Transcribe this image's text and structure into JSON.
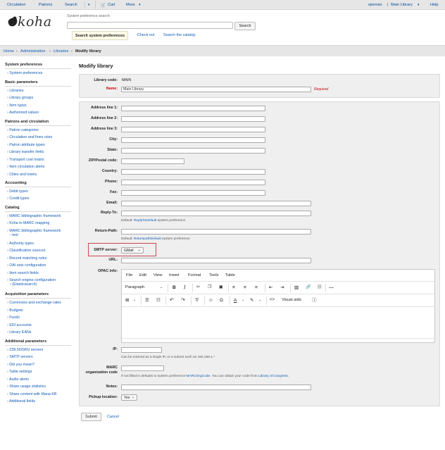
{
  "topnav": {
    "circulation": "Circulation",
    "patrons": "Patrons",
    "search": "Search",
    "cart": "Cart",
    "more": "More",
    "user": "opensio",
    "library": "Main Library",
    "help": "Help"
  },
  "search": {
    "label": "System preference search:",
    "button": "Search",
    "tabs": [
      "Search system preferences",
      "Check out",
      "Search the catalog"
    ]
  },
  "logo": "koha",
  "breadcrumb": [
    "Home",
    "Administration",
    "Libraries",
    "Modify library"
  ],
  "sidebar": {
    "sections": [
      {
        "title": "System preferences",
        "items": [
          "System preferences"
        ]
      },
      {
        "title": "Basic parameters",
        "items": [
          "Libraries",
          "Library groups",
          "Item types",
          "Authorized values"
        ]
      },
      {
        "title": "Patrons and circulation",
        "items": [
          "Patron categories",
          "Circulation and fines rules",
          "Patron attribute types",
          "Library transfer limits",
          "Transport cost matrix",
          "Item circulation alerts",
          "Cities and towns"
        ]
      },
      {
        "title": "Accounting",
        "items": [
          "Debit types",
          "Credit types"
        ]
      },
      {
        "title": "Catalog",
        "items": [
          "MARC bibliographic framework",
          "Koha to MARC mapping",
          "MARC bibliographic framework",
          "Authority types",
          "Classification sources",
          "Record matching rules",
          "OAI sets configuration",
          "Item search fields",
          "Search engine configuration"
        ]
      },
      {
        "title": "Acquisition parameters",
        "items": [
          "Currencies and exchange rates",
          "Budgets",
          "Funds",
          "EDI accounts",
          "Library EANs"
        ]
      },
      {
        "title": "Additional parameters",
        "items": [
          "Z39.50/SRU servers",
          "SMTP servers",
          "Did you mean?",
          "Table settings",
          "Audio alerts",
          "Share usage statistics",
          "Share content with Mana KB",
          "Additional fields"
        ]
      }
    ],
    "wrap": {
      "test": "test",
      "es": "(Elasticsearch)"
    }
  },
  "page_title": "Modify library",
  "form": {
    "library_code_label": "Library code:",
    "library_code": "MAIN",
    "name_label": "Name:",
    "name_value": "Main Library",
    "required": "Required",
    "address1": "Address line 1:",
    "address2": "Address line 2:",
    "address3": "Address line 3:",
    "city": "City:",
    "state": "State:",
    "zip": "ZIP/Postal code:",
    "country": "Country:",
    "phone": "Phone:",
    "fax": "Fax:",
    "email": "Email:",
    "replyto": "Reply-To:",
    "replyto_hint_pre": "Default:",
    "replyto_hint_link": "ReplyToDefault",
    "replyto_hint_post": "system preference",
    "returnpath": "Return-Path:",
    "returnpath_hint_pre": "Default:",
    "returnpath_hint_link": "ReturnpathDefault",
    "returnpath_hint_post": "system preference",
    "smtp_label": "SMTP server:",
    "smtp_value": "GMail",
    "url": "URL:",
    "opac_info": "OPAC info:",
    "ip": "IP:",
    "ip_hint": "Can be entered as a single IP, or a subnet such as 192.168.1.*",
    "marc_org_label": "MARC",
    "marc_org_label2": "organization code",
    "marc_hint_pre": "If not filled in defaults to system preference",
    "marc_hint_link": "MARCOrgCode",
    "marc_hint_mid": ". You can obtain your code from",
    "marc_hint_link2": "Library of Congress",
    "marc_hint_end": ".",
    "notes": "Notes:",
    "pickup": "Pickup location:",
    "pickup_value": "Yes",
    "submit": "Submit",
    "cancel": "Cancel"
  },
  "editor": {
    "menus": [
      "File",
      "Edit",
      "View",
      "Insert",
      "Format",
      "Tools",
      "Table"
    ],
    "block": "Paragraph",
    "visual_aids": "Visual aids"
  },
  "colors": {
    "link": "#0f5bb8",
    "highlight": "#c8494f"
  }
}
